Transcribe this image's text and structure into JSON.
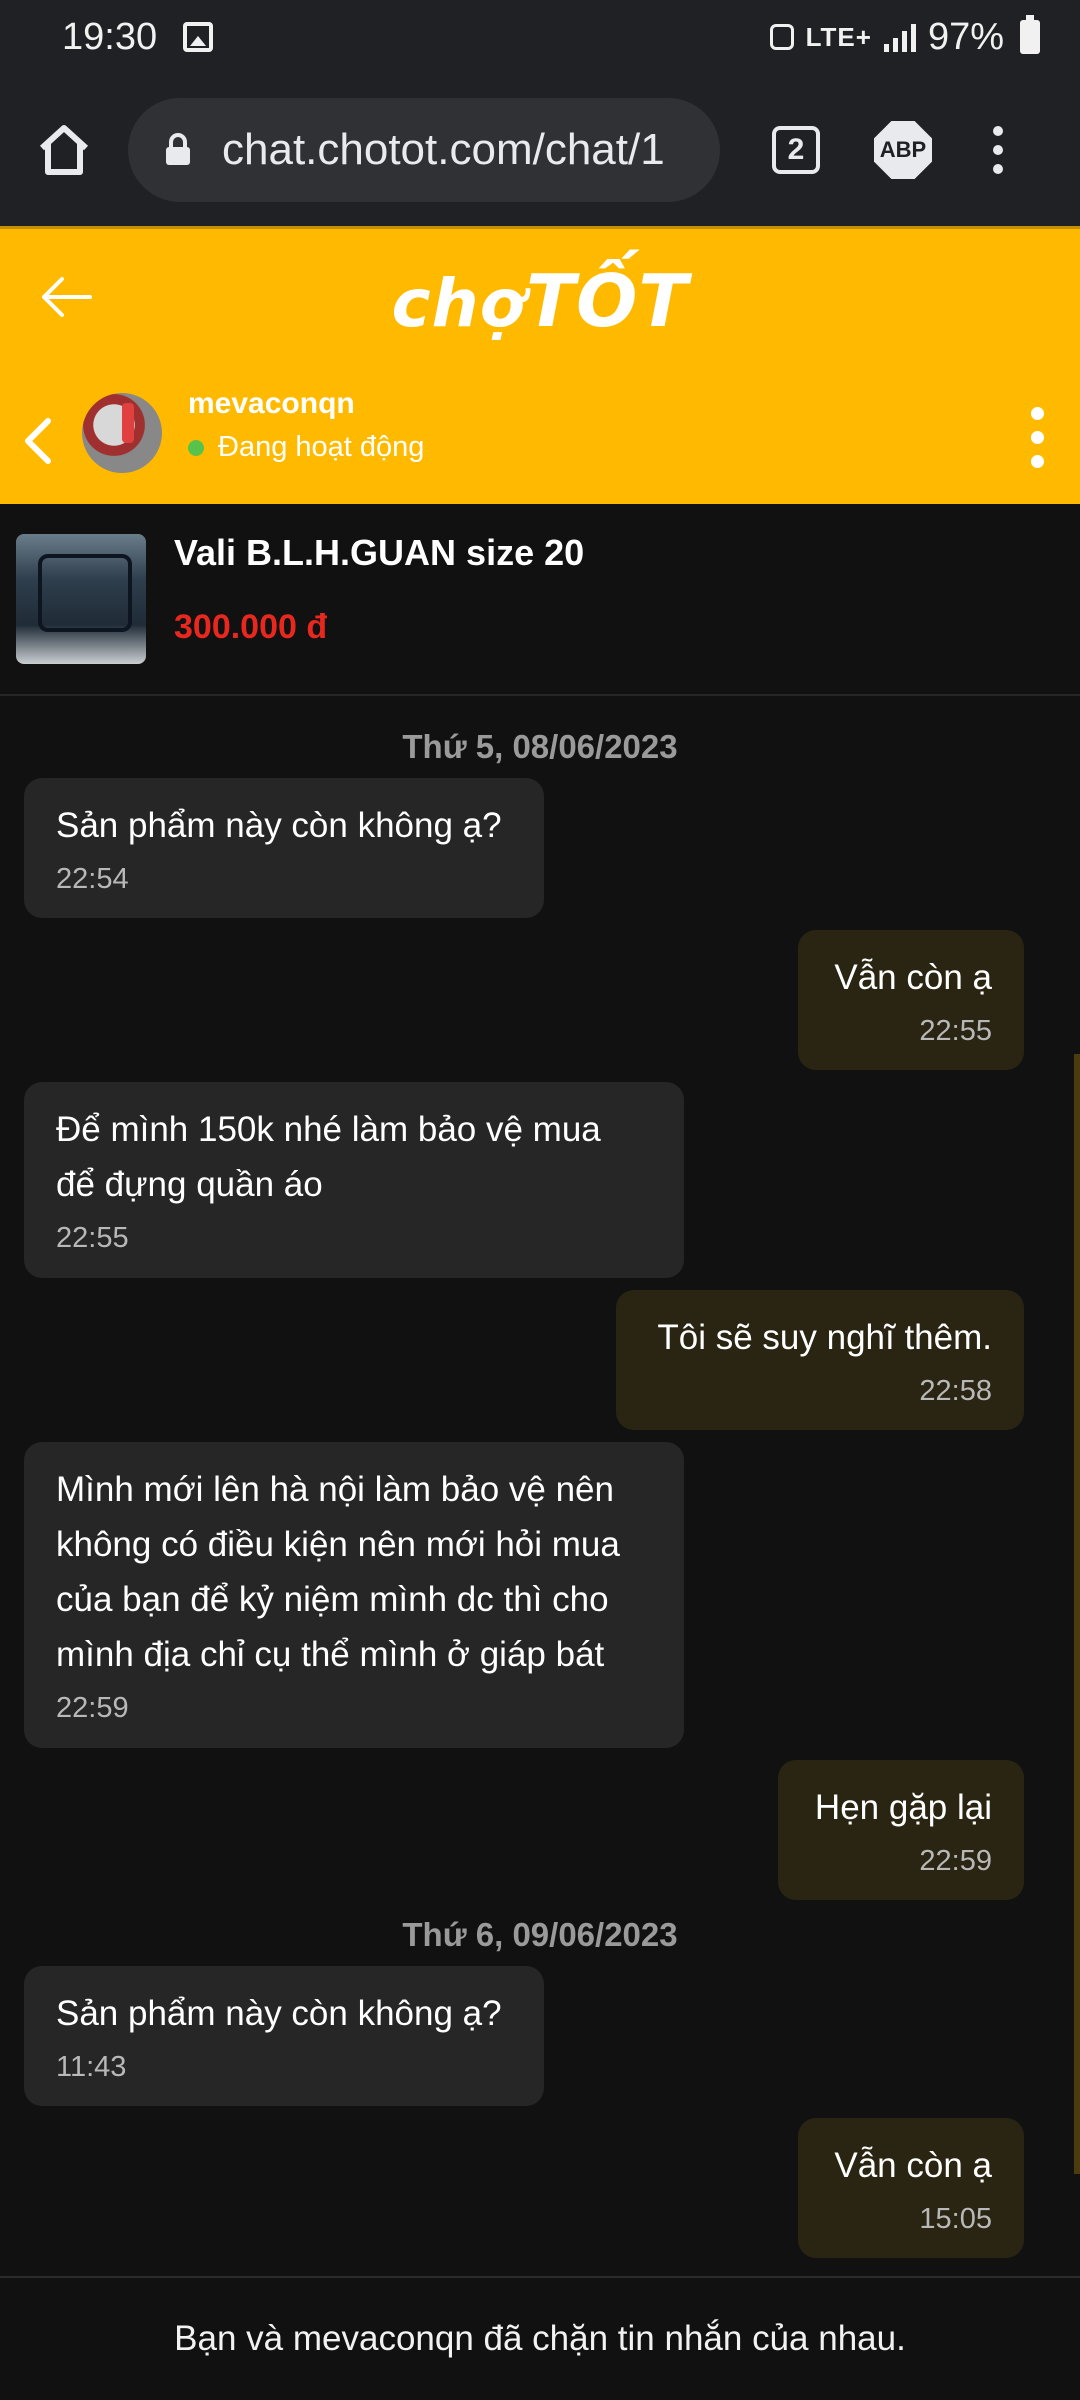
{
  "status_bar": {
    "time": "19:30",
    "network": "LTE+",
    "battery": "97%"
  },
  "browser": {
    "url": "chat.chotot.com/chat/1",
    "tab_count": "2",
    "adblock_label": "ABP"
  },
  "app_header": {
    "logo_part1": "chợ",
    "logo_part2": "TỐT",
    "accent_color": "#ffba00"
  },
  "chat_header": {
    "user_name": "mevaconqn",
    "status_text": "Đang hoạt động"
  },
  "product": {
    "title": "Vali B.L.H.GUAN size 20",
    "price": "300.000 đ"
  },
  "messages": [
    {
      "date": "Thứ 5, 08/06/2023"
    },
    {
      "text": "Sản phẩm này còn không ạ?",
      "time": "22:54"
    },
    {
      "text": "Vẫn còn ạ",
      "time": "22:55"
    },
    {
      "text_line1": "Để mình 150k nhé làm bảo vệ mua",
      "text_line2": "để đựng quần áo",
      "time": "22:55"
    },
    {
      "text": "Tôi sẽ suy nghĩ thêm.",
      "time": "22:58"
    },
    {
      "text_line1": "Mình mới lên hà nội làm bảo vệ nên",
      "text_line2": "không có điều kiện nên mới hỏi mua",
      "text_line3": "của bạn để kỷ niệm mình dc thì cho",
      "text_line4": "mình địa chỉ cụ thể mình ở giáp bát",
      "time": "22:59"
    },
    {
      "text": "Hẹn gặp lại",
      "time": "22:59"
    },
    {
      "date": "Thứ 6, 09/06/2023"
    },
    {
      "text": "Sản phẩm này còn không ạ?",
      "time": "11:43"
    },
    {
      "text": "Vẫn còn ạ",
      "time": "15:05"
    }
  ],
  "footer": {
    "blocked_notice": "Bạn và mevaconqn đã chặn tin nhắn của nhau."
  }
}
